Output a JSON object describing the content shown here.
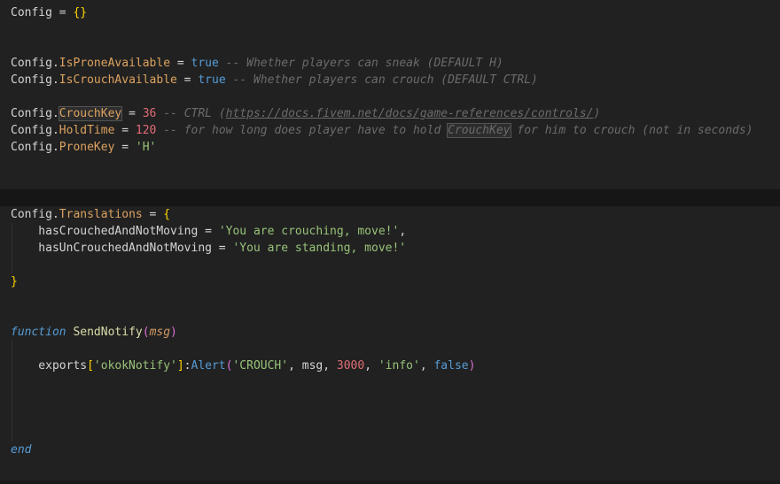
{
  "theme": {
    "bg": "#212121",
    "currentLineBg": "#161616",
    "indentGuide": "#333333",
    "panelEdge": "#191919",
    "occBorder": "#545454",
    "plain": "#d4d4d4",
    "prop": "#dca260",
    "kw": "#569cd6",
    "str": "#98c379",
    "num": "#e06c75",
    "com": "#6b6b6b",
    "fname": "#dcdcaa",
    "fcall": "#569cd6",
    "b1": "#ffd700",
    "b2": "#da70d6",
    "param": "#d19a66"
  },
  "editor": {
    "language": "lua",
    "lines": [
      {
        "segments": [
          {
            "t": "Config = ",
            "c": "plain"
          },
          {
            "t": "{}",
            "c": "b1"
          }
        ]
      },
      {
        "segments": []
      },
      {
        "segments": []
      },
      {
        "segments": [
          {
            "t": "Config.",
            "c": "plain"
          },
          {
            "t": "IsProneAvailable",
            "c": "prop"
          },
          {
            "t": " = ",
            "c": "plain"
          },
          {
            "t": "true",
            "c": "kw"
          },
          {
            "t": " ",
            "c": "plain"
          },
          {
            "t": "-- Whether players can sneak (DEFAULT H)",
            "c": "com"
          }
        ]
      },
      {
        "segments": [
          {
            "t": "Config.",
            "c": "plain"
          },
          {
            "t": "IsCrouchAvailable",
            "c": "prop"
          },
          {
            "t": " = ",
            "c": "plain"
          },
          {
            "t": "true",
            "c": "kw"
          },
          {
            "t": " ",
            "c": "plain"
          },
          {
            "t": "-- Whether players can crouch (DEFAULT CTRL)",
            "c": "com"
          }
        ]
      },
      {
        "segments": []
      },
      {
        "segments": [
          {
            "t": "Config.",
            "c": "plain"
          },
          {
            "t": "CrouchKey",
            "c": "prop",
            "box": true
          },
          {
            "t": " = ",
            "c": "plain"
          },
          {
            "t": "36",
            "c": "num"
          },
          {
            "t": " ",
            "c": "plain"
          },
          {
            "t": "-- CTRL (",
            "c": "com"
          },
          {
            "t": "https://docs.fivem.net/docs/game-references/controls/",
            "c": "comlink"
          },
          {
            "t": ")",
            "c": "com"
          }
        ]
      },
      {
        "segments": [
          {
            "t": "Config.",
            "c": "plain"
          },
          {
            "t": "HoldTime",
            "c": "prop"
          },
          {
            "t": " = ",
            "c": "plain"
          },
          {
            "t": "120",
            "c": "num"
          },
          {
            "t": " ",
            "c": "plain"
          },
          {
            "t": "-- for how long does player have to hold ",
            "c": "com"
          },
          {
            "t": "CrouchKey",
            "c": "com",
            "box": true
          },
          {
            "t": " for him to crouch (not in seconds)",
            "c": "com"
          }
        ]
      },
      {
        "segments": [
          {
            "t": "Config.",
            "c": "plain"
          },
          {
            "t": "ProneKey",
            "c": "prop"
          },
          {
            "t": " = ",
            "c": "plain"
          },
          {
            "t": "'H'",
            "c": "str"
          }
        ]
      },
      {
        "segments": []
      },
      {
        "segments": []
      },
      {
        "segments": [],
        "current": true
      },
      {
        "segments": [
          {
            "t": "Config.",
            "c": "plain"
          },
          {
            "t": "Translations",
            "c": "prop"
          },
          {
            "t": " = ",
            "c": "plain"
          },
          {
            "t": "{",
            "c": "b1"
          }
        ]
      },
      {
        "segments": [
          {
            "t": "    hasCrouchedAndNotMoving = ",
            "c": "plain"
          },
          {
            "t": "'You are crouching, move!'",
            "c": "str"
          },
          {
            "t": ",",
            "c": "plain"
          }
        ],
        "guide": true
      },
      {
        "segments": [
          {
            "t": "    hasUnCrouchedAndNotMoving = ",
            "c": "plain"
          },
          {
            "t": "'You are standing, move!'",
            "c": "str"
          }
        ],
        "guide": true
      },
      {
        "segments": [],
        "guide": true
      },
      {
        "segments": [
          {
            "t": "}",
            "c": "b1"
          }
        ]
      },
      {
        "segments": []
      },
      {
        "segments": []
      },
      {
        "segments": [
          {
            "t": "function",
            "c": "kwi"
          },
          {
            "t": " ",
            "c": "plain"
          },
          {
            "t": "SendNotify",
            "c": "fname"
          },
          {
            "t": "(",
            "c": "b2"
          },
          {
            "t": "msg",
            "c": "param"
          },
          {
            "t": ")",
            "c": "b2"
          }
        ]
      },
      {
        "segments": [],
        "guide": true
      },
      {
        "segments": [
          {
            "t": "    exports",
            "c": "plain"
          },
          {
            "t": "[",
            "c": "b1"
          },
          {
            "t": "'okokNotify'",
            "c": "str"
          },
          {
            "t": "]",
            "c": "b1"
          },
          {
            "t": ":",
            "c": "plain"
          },
          {
            "t": "Alert",
            "c": "fcall"
          },
          {
            "t": "(",
            "c": "b2"
          },
          {
            "t": "'CROUCH'",
            "c": "str"
          },
          {
            "t": ", msg, ",
            "c": "plain"
          },
          {
            "t": "3000",
            "c": "num"
          },
          {
            "t": ", ",
            "c": "plain"
          },
          {
            "t": "'info'",
            "c": "str"
          },
          {
            "t": ", ",
            "c": "plain"
          },
          {
            "t": "false",
            "c": "kw"
          },
          {
            "t": ")",
            "c": "b2"
          }
        ],
        "guide": true
      },
      {
        "segments": [],
        "guide": true
      },
      {
        "segments": [],
        "guide": true
      },
      {
        "segments": [],
        "guide": true
      },
      {
        "segments": [],
        "guide": true
      },
      {
        "segments": [
          {
            "t": "end",
            "c": "kwi"
          }
        ]
      },
      {
        "segments": []
      }
    ]
  }
}
